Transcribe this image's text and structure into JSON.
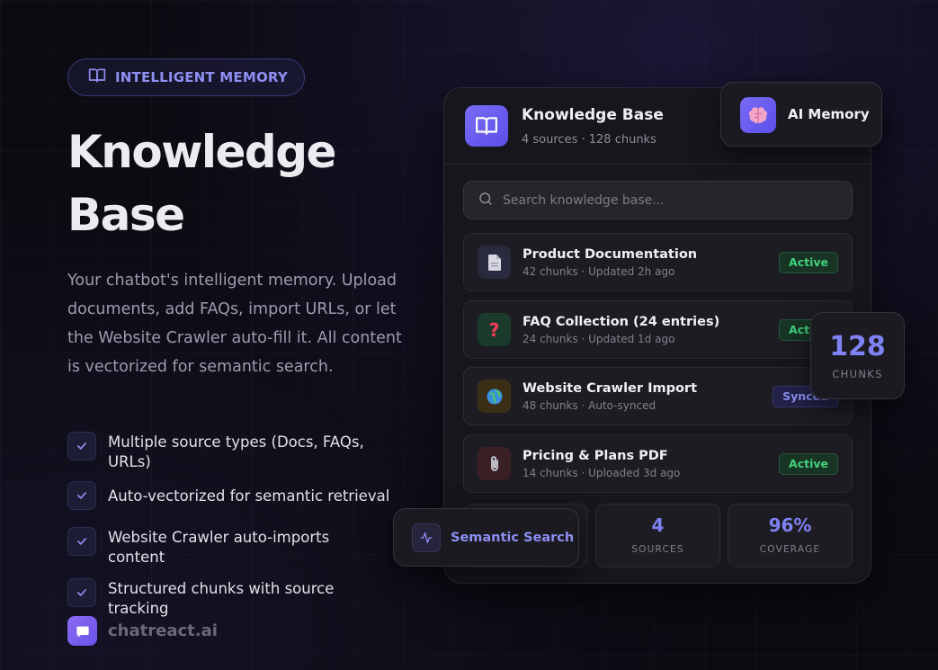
{
  "hero": {
    "pill_label": "INTELLIGENT MEMORY",
    "title_line1": "Knowledge",
    "title_line2": "Base",
    "description": "Your chatbot's intelligent memory. Upload documents, add FAQs, import URLs, or let the Website Crawler auto-fill it. All content is vectorized for semantic search.",
    "features": [
      "Multiple source types (Docs, FAQs, URLs)",
      "Auto-vectorized for semantic retrieval",
      "Website Crawler auto-imports content",
      "Structured chunks with source tracking"
    ]
  },
  "brand": {
    "name": "chatreact.ai"
  },
  "card": {
    "title": "Knowledge Base",
    "subtitle": "4 sources · 128 chunks",
    "search_placeholder": "Search knowledge base...",
    "sources": [
      {
        "name": "Product Documentation",
        "meta": "42 chunks · Updated 2h ago",
        "status": "Active",
        "icon": "document-icon"
      },
      {
        "name": "FAQ Collection (24 entries)",
        "meta": "24 chunks · Updated 1d ago",
        "status": "Active",
        "icon": "question-icon"
      },
      {
        "name": "Website Crawler Import",
        "meta": "48 chunks · Auto-synced",
        "status": "Synced",
        "icon": "globe-icon"
      },
      {
        "name": "Pricing & Plans PDF",
        "meta": "14 chunks · Uploaded 3d ago",
        "status": "Active",
        "icon": "paperclip-icon"
      }
    ],
    "stats": [
      {
        "value": "4",
        "label": "SOURCES"
      },
      {
        "value": "96%",
        "label": "COVERAGE"
      }
    ]
  },
  "floating": {
    "ai_memory_label": "AI Memory",
    "chunks_value": "128",
    "chunks_label": "CHUNKS",
    "semantic_label": "Semantic Search"
  },
  "colors": {
    "accent": "#7f82f4",
    "active_green": "#43d07d",
    "background": "#0c0b12",
    "card": "#17161c"
  }
}
